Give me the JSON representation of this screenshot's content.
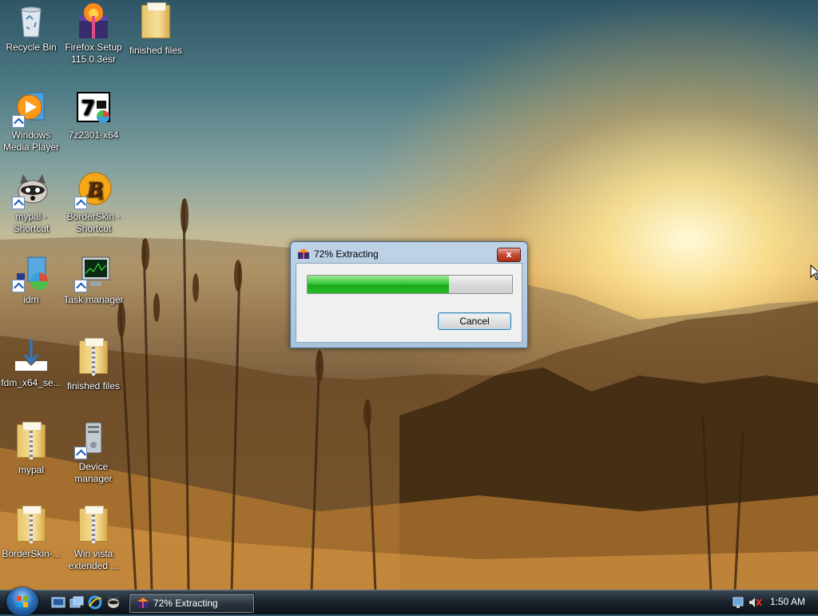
{
  "desktop": {
    "icons": [
      {
        "label": "Recycle Bin",
        "icon": "recycle-bin-icon"
      },
      {
        "label": "Firefox Setup\n115.0.3esr",
        "icon": "firefox-installer-icon"
      },
      {
        "label": "finished files",
        "icon": "folder-icon"
      },
      {
        "label": "Windows\nMedia Player",
        "icon": "media-player-icon"
      },
      {
        "label": "7z2301-x64",
        "icon": "7zip-installer-icon"
      },
      {
        "label": "mypal -\nShortcut",
        "icon": "raccoon-icon"
      },
      {
        "label": "BorderSkin -\nShortcut",
        "icon": "borderskin-icon"
      },
      {
        "label": "idm",
        "icon": "idm-icon"
      },
      {
        "label": "Task manager",
        "icon": "task-manager-icon"
      },
      {
        "label": "fdm_x64_se...",
        "icon": "download-icon"
      },
      {
        "label": "finished files",
        "icon": "zip-folder-icon"
      },
      {
        "label": "mypal",
        "icon": "zip-folder-icon"
      },
      {
        "label": "Device\nmanager",
        "icon": "device-manager-icon"
      },
      {
        "label": "BorderSkin-...",
        "icon": "zip-folder-icon"
      },
      {
        "label": "Win vista\nextended ...",
        "icon": "zip-folder-icon"
      }
    ]
  },
  "dialog": {
    "title": "72% Extracting",
    "progress": 0.69,
    "cancel_label": "Cancel",
    "close_label": "x"
  },
  "taskbar": {
    "task_label": "72% Extracting",
    "clock": "1:50 AM",
    "colors": {
      "progress_green": "#27bc27",
      "taskbar_dark": "#1b242d"
    }
  }
}
